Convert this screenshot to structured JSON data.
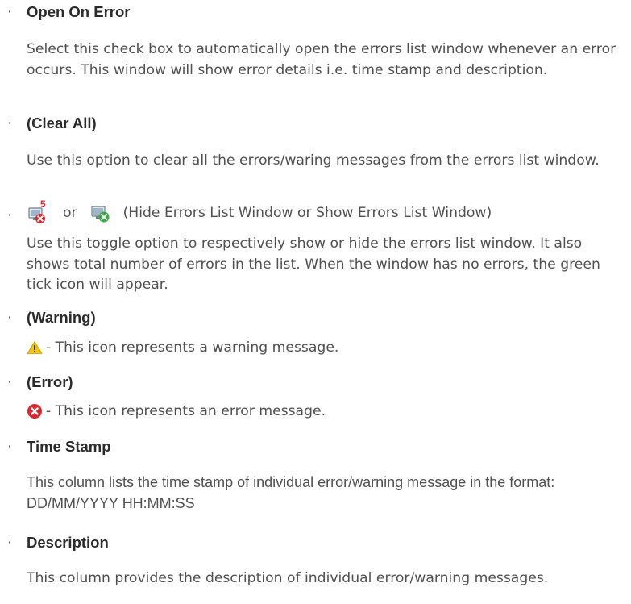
{
  "items": [
    {
      "heading": "Open On Error",
      "body": "Select this check box to automatically open the errors list window whenever an error occurs. This window will show error details i.e. time stamp and description."
    },
    {
      "heading": "(Clear All)",
      "body": "Use this option to clear all the errors/waring messages from the errors list window."
    },
    {
      "or_text": "or",
      "toggle_label": "(Hide Errors List Window or Show Errors List Window)",
      "body": "Use this toggle option to respectively show or hide the errors list window. It also shows total number of errors in the list. When the window has no errors, the green tick icon will appear.",
      "error_count_badge": "5",
      "icons": [
        "errors-list-with-count-icon",
        "errors-list-no-errors-icon"
      ]
    },
    {
      "heading": "(Warning)",
      "body": " - This icon represents a warning message.",
      "icon": "warning-icon"
    },
    {
      "heading": "(Error)",
      "body": " - This icon represents an error message.",
      "icon": "error-icon"
    },
    {
      "heading": "Time Stamp",
      "body": "This column lists the time stamp of individual error/warning message in the format: DD/MM/YYYY HH:MM:SS"
    },
    {
      "heading": "Description",
      "body": "This column provides the description of individual error/warning messages."
    }
  ],
  "colors": {
    "warning": "#f5c400",
    "error": "#d9282f",
    "ok": "#3aa845",
    "text": "#505050",
    "heading": "#2b2b2b"
  }
}
